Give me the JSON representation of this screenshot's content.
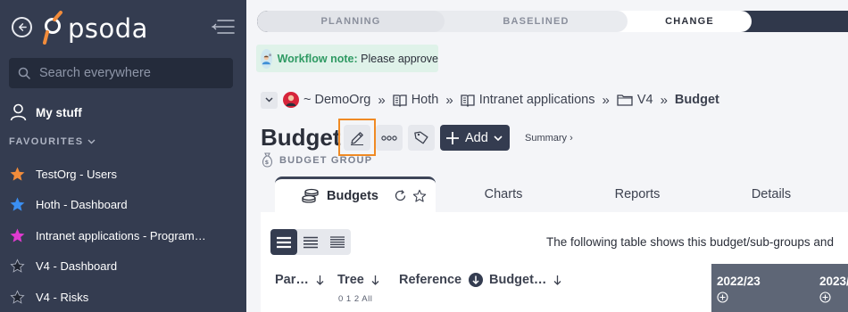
{
  "app": {
    "logo_text": "psoda",
    "search_placeholder": "Search everywhere",
    "my_stuff_label": "My stuff",
    "favourites_label": "FAVOURITES",
    "favourites": [
      {
        "label": "TestOrg - Users",
        "star_color": "#f28c3b"
      },
      {
        "label": "Hoth - Dashboard",
        "star_color": "#3b8ff2"
      },
      {
        "label": "Intranet applications - Programme…",
        "star_color": "#e03ad0"
      },
      {
        "label": "V4 - Dashboard",
        "star_color": "#1f2430"
      },
      {
        "label": "V4 - Risks",
        "star_color": "#1f2430"
      }
    ]
  },
  "workflow": {
    "steps": [
      "PLANNING",
      "BASELINED",
      "CHANGE"
    ],
    "active_step": "CHANGE",
    "note_label": "Workflow note:",
    "note_message": "Please approve"
  },
  "breadcrumb": [
    {
      "label": "~ DemoOrg",
      "icon": "org-avatar-icon"
    },
    {
      "label": "Hoth",
      "icon": "book-icon"
    },
    {
      "label": "Intranet applications",
      "icon": "book-icon"
    },
    {
      "label": "V4",
      "icon": "folder-icon"
    },
    {
      "label": "Budget",
      "icon": ""
    }
  ],
  "page": {
    "title": "Budget",
    "type_label": "BUDGET GROUP",
    "add_label": "Add",
    "summary_link": "Summary ›"
  },
  "tabs": [
    {
      "label": "Budgets",
      "active": true
    },
    {
      "label": "Charts",
      "active": false
    },
    {
      "label": "Reports",
      "active": false
    },
    {
      "label": "Details",
      "active": false
    }
  ],
  "content": {
    "description": "The following table shows this budget/sub-groups and",
    "columns": {
      "par": "Par…",
      "tree": "Tree",
      "reference": "Reference",
      "budget": "Budget…"
    },
    "tree_levels": "0 1 2 All",
    "years": [
      "2022/23",
      "2023/"
    ]
  },
  "colors": {
    "sidebar_bg": "#343c50",
    "accent_orange": "#f08a24",
    "workflow_note_bg": "#dff2e9",
    "workflow_note_label": "#2f9a63"
  }
}
